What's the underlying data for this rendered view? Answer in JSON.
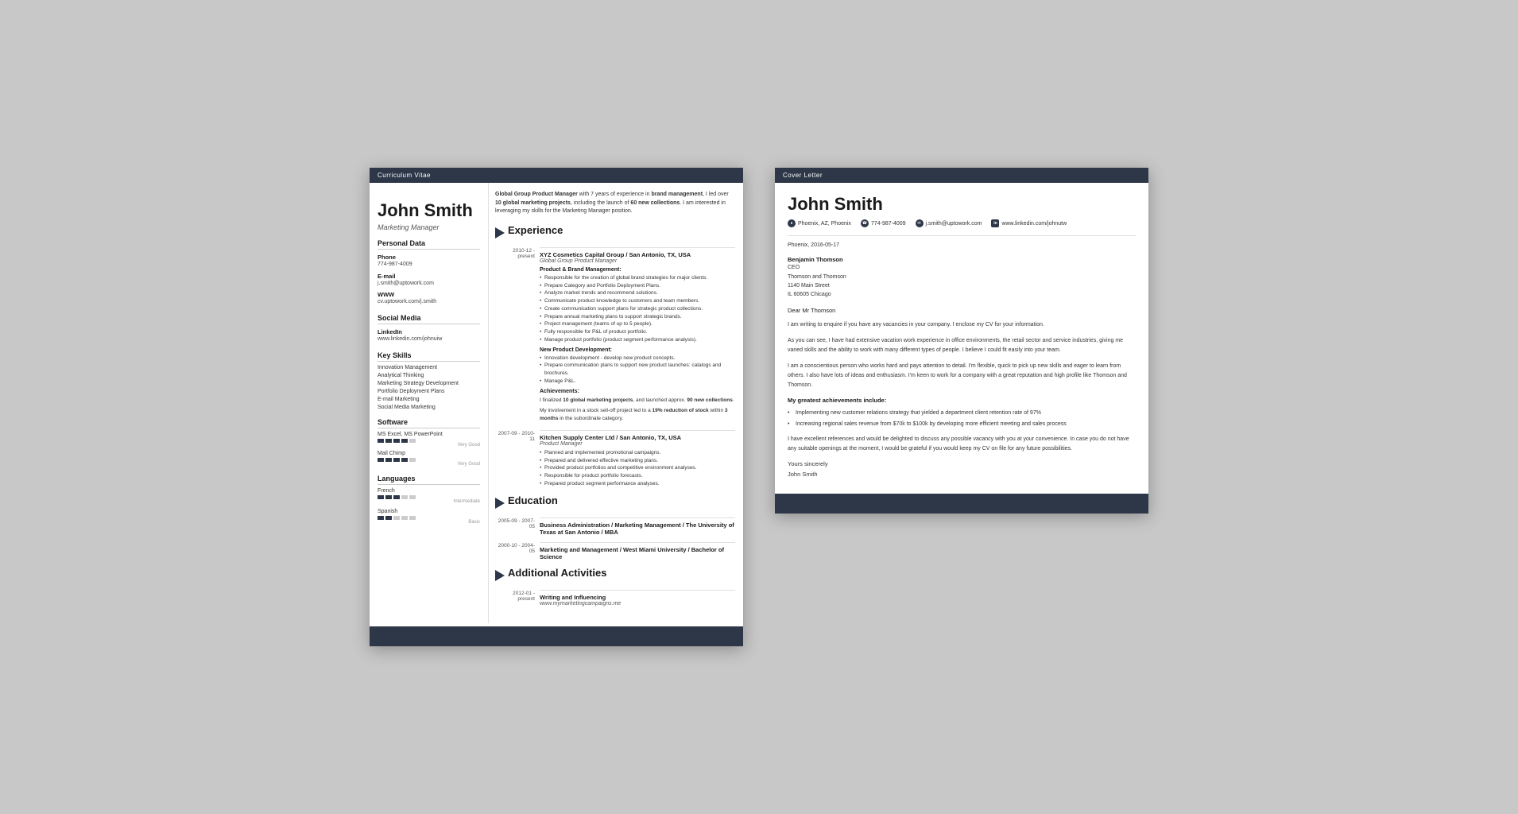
{
  "cv": {
    "header_bar": "Curriculum Vitae",
    "name": "John Smith",
    "title": "Marketing Manager",
    "intro": {
      "bold1": "Global Group Product Manager",
      "text1": " with 7 years of experience in ",
      "bold2": "brand management",
      "text2": ", I led over ",
      "bold3": "10 global marketing projects",
      "text3": ", including the launch of ",
      "bold4": "60 new collections",
      "text4": ". I am interested in leveraging my skills for the Marketing Manager position."
    },
    "personal_data": {
      "section_title": "Personal Data",
      "phone_label": "Phone",
      "phone": "774-987-4009",
      "email_label": "E-mail",
      "email": "j.smith@uptowork.com",
      "www_label": "WWW",
      "www": "cv.uptowork.com/j.smith"
    },
    "social_media": {
      "section_title": "Social Media",
      "linkedin_label": "LinkedIn",
      "linkedin": "www.linkedin.com/johnuiw"
    },
    "key_skills": {
      "section_title": "Key Skills",
      "items": [
        "Innovation Management",
        "Analytical Thinking",
        "Marketing Strategy Development",
        "Portfolio Deployment Plans",
        "E-mail Marketing",
        "Social Media Marketing"
      ]
    },
    "software": {
      "section_title": "Software",
      "items": [
        {
          "name": "MS Excel, MS PowerPoint",
          "filled": 4,
          "total": 5,
          "label": "Very Good"
        },
        {
          "name": "Mail Chimp",
          "filled": 4,
          "total": 5,
          "label": "Very Good"
        }
      ]
    },
    "languages": {
      "section_title": "Languages",
      "items": [
        {
          "name": "French",
          "filled": 3,
          "total": 5,
          "label": "Intermediate"
        },
        {
          "name": "Spanish",
          "filled": 2,
          "total": 5,
          "label": "Basic"
        }
      ]
    },
    "experience": {
      "section_title": "Experience",
      "entries": [
        {
          "date": "2010-12 - present",
          "company": "XYZ Cosmetics Capital Group / San Antonio, TX, USA",
          "role": "Global Group Product Manager",
          "sections": [
            {
              "subtitle": "Product & Brand Management:",
              "bullets": [
                "Responsible for the creation of global brand strategies for major clients.",
                "Prepare Category and Portfolio Deployment Plans.",
                "Analyze market trends and recommend solutions.",
                "Communicate product knowledge to customers and team members.",
                "Create communication support plans for strategic product collections.",
                "Prepare annual marketing plans to support strategic brands.",
                "Project management (teams of up to 5 people).",
                "Fully responsible for P&L of product portfolio.",
                "Manage product portfolio (product segment performance analysis)."
              ]
            },
            {
              "subtitle": "New Product Development:",
              "bullets": [
                "Innovation development - develop new product concepts.",
                "Prepare communication plans to support new product launches: catalogs and brochures.",
                "Manage P&L."
              ]
            },
            {
              "subtitle": "Achievements:",
              "achievement_lines": [
                {
                  "text": "I finalized ",
                  "bold": "10 global marketing projects",
                  "text2": ", and launched approx. ",
                  "bold2": "90 new collections",
                  "text3": "."
                },
                {
                  "text": "My involvement in a stock sell-off project led to a ",
                  "bold": "19% reduction of stock",
                  "text2": " within ",
                  "bold2": "3 months",
                  "text3": " in the subordinate category."
                }
              ]
            }
          ]
        },
        {
          "date": "2007-09 - 2010-11",
          "company": "Kitchen Supply Center Ltd / San Antonio, TX, USA",
          "role": "Product Manager",
          "bullets": [
            "Planned and implemented promotional campaigns.",
            "Prepared and delivered effective marketing plans.",
            "Provided product portfolios and competitive environment analyses.",
            "Responsible for product portfolio forecasts.",
            "Prepared product segment performance analyses."
          ]
        }
      ]
    },
    "education": {
      "section_title": "Education",
      "entries": [
        {
          "date": "2005-09 - 2007-05",
          "degree": "Business Administration / Marketing Management / The University of Texas at San Antonio / MBA"
        },
        {
          "date": "2000-10 - 2004-05",
          "degree": "Marketing and Management / West Miami University / Bachelor of Science"
        }
      ]
    },
    "additional": {
      "section_title": "Additional Activities",
      "entries": [
        {
          "date": "2012-01 - present",
          "title": "Writing and Influencing",
          "detail": "www.mymarketingcampaigns.me"
        }
      ]
    }
  },
  "cover": {
    "header_bar": "Cover Letter",
    "name": "John Smith",
    "contact": {
      "location": "Phoenix, AZ, Phoenix",
      "phone": "774-987-4009",
      "email": "j.smith@uptowork.com",
      "linkedin": "www.linkedin.com/johnutw"
    },
    "date": "Phoenix, 2016-05-17",
    "recipient": {
      "name": "Benjamin Thomson",
      "title": "CEO",
      "company": "Thomson and Thomson",
      "address": "1140 Main Street",
      "city": "IL 60605 Chicago"
    },
    "salutation": "Dear Mr Thomson",
    "paragraphs": [
      "I am writing to enquire if you have any vacancies in your company. I enclose my CV for your information.",
      "As you can see, I have had extensive vacation work experience in office environments, the retail sector and service industries, giving me varied skills and the ability to work with many different types of people. I believe I could fit easily into your team.",
      "I am a conscientious person who works hard and pays attention to detail. I'm flexible, quick to pick up new skills and eager to learn from others. I also have lots of ideas and enthusiasm. I'm keen to work for a company with a great reputation and high profile like Thomson and Thomson."
    ],
    "achievements_title": "My greatest achievements include:",
    "achievements": [
      "Implementing new customer relations strategy that yielded a department client retention rate of 97%",
      "Increasing regional sales revenue from $70k to $100k by developing more efficient meeting and sales process"
    ],
    "closing": "I have excellent references and would be delighted to discuss any possible vacancy with you at your convenience. In case you do not have any suitable openings at the moment, I would be grateful if you would keep my CV on file for any future possibilities.",
    "sign_off": "Yours sincerely",
    "sig_name": "John Smith"
  }
}
